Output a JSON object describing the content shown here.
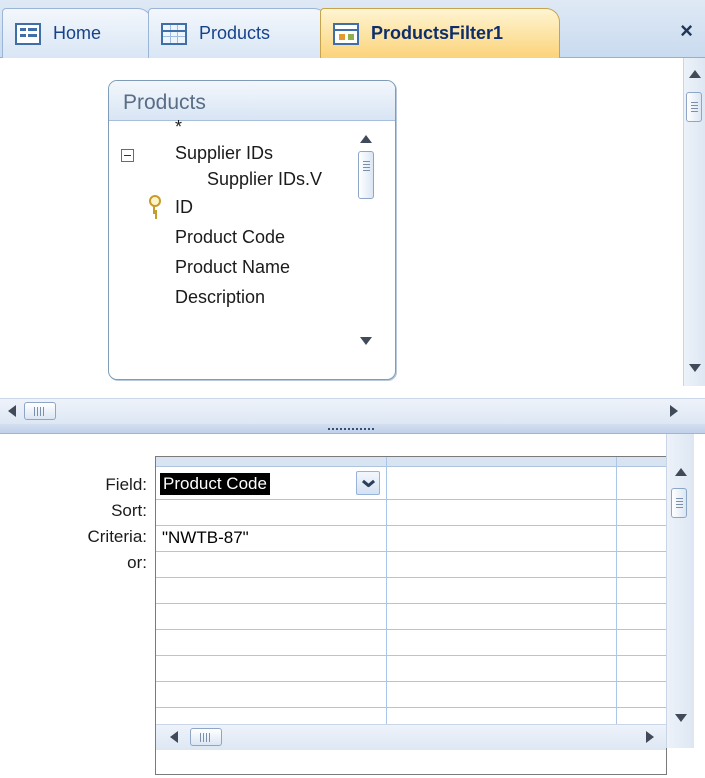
{
  "tabs": [
    {
      "label": "Home",
      "icon": "home-form-icon",
      "active": false
    },
    {
      "label": "Products",
      "icon": "table-icon",
      "active": false
    },
    {
      "label": "ProductsFilter1",
      "icon": "query-icon",
      "active": true
    }
  ],
  "close_glyph": "×",
  "field_list": {
    "title": "Products",
    "items": [
      {
        "label": "*",
        "indent": 0
      },
      {
        "label": "Supplier IDs",
        "indent": 0,
        "expander": "collapse"
      },
      {
        "label": "Supplier IDs.V",
        "indent": 1
      },
      {
        "label": "ID",
        "indent": 0,
        "primary_key": true
      },
      {
        "label": "Product Code",
        "indent": 0
      },
      {
        "label": "Product Name",
        "indent": 0
      },
      {
        "label": "Description",
        "indent": 0
      }
    ]
  },
  "design_grid": {
    "row_labels": [
      "Field:",
      "Sort:",
      "Criteria:",
      "or:"
    ],
    "columns": [
      {
        "field": "Product Code",
        "sort": "",
        "criteria": "\"NWTB-87\"",
        "or": ""
      },
      {
        "field": "",
        "sort": "",
        "criteria": "",
        "or": ""
      }
    ]
  },
  "colors": {
    "active_tab": "#fbd37a",
    "tab_text": "#15428b",
    "grid_line": "#aac6e8"
  }
}
